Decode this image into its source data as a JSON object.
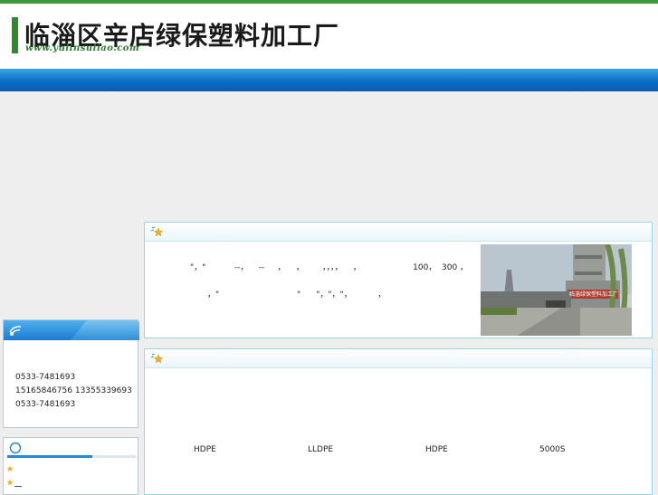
{
  "header": {
    "title": "临淄区辛店绿保塑料加工厂",
    "url": "www.yulinsuliao.com"
  },
  "intro": {
    "line1": "\"，\"           --，    --     ，    ，       ，，，，    ，                    100，  300 ，",
    "line2": "，\"                              \"      \"，\"，\"，          ，",
    "photo_sign": "临淄绿保塑料加工厂"
  },
  "contact": {
    "phone1": "0533-7481693",
    "mobiles": "15165846756 13355339693",
    "phone2": "0533-7481693"
  },
  "products": {
    "items": [
      "HDPE",
      "LLDPE",
      "HDPE",
      "5000S"
    ]
  },
  "colors": {
    "brand_green": "#2f8a2f",
    "nav_blue": "#0d6ec8",
    "panel_border": "#9bd4e2"
  }
}
